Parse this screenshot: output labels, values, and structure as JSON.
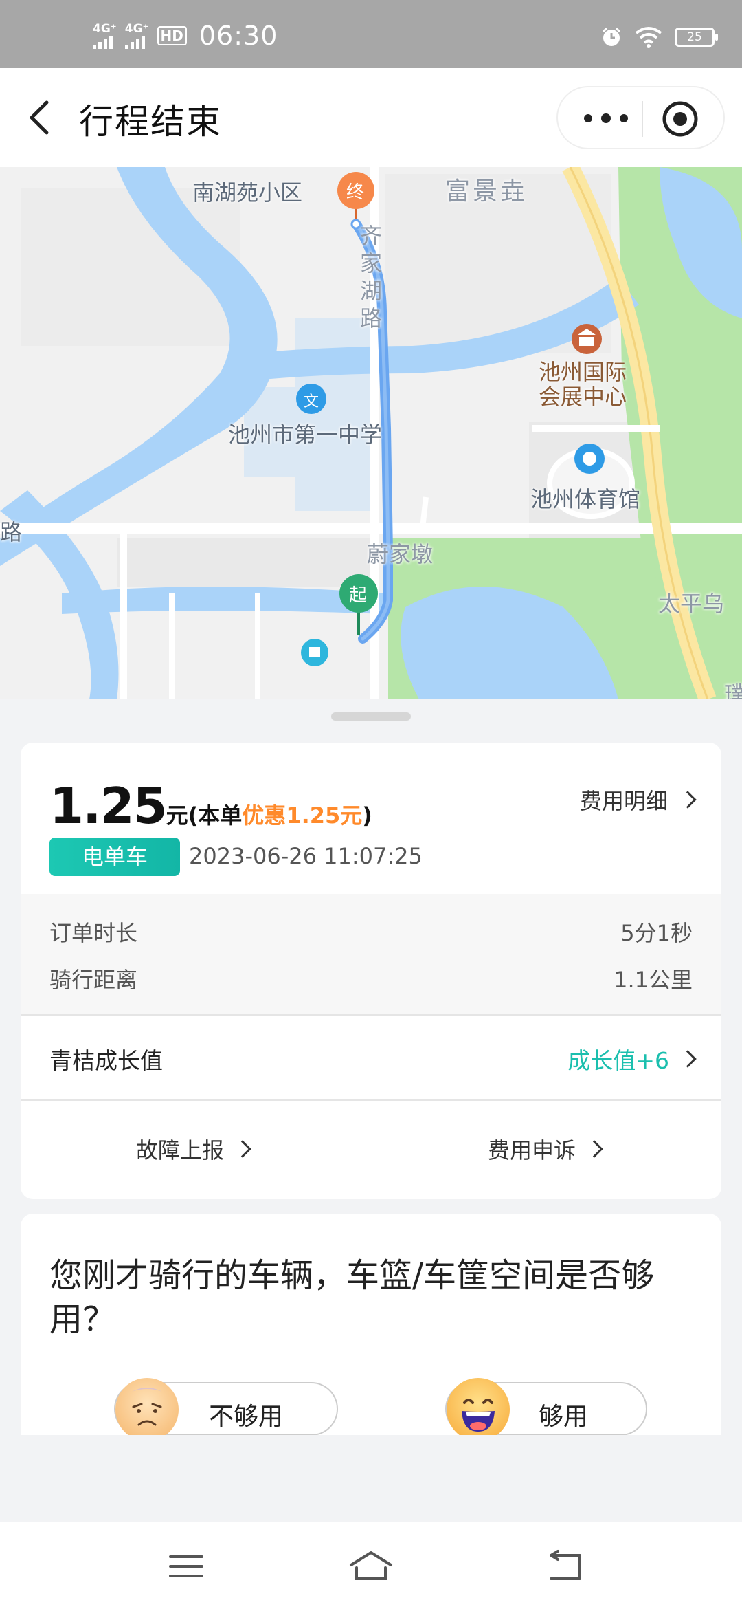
{
  "status_bar": {
    "network1": "4G⁺",
    "network2": "4G⁺",
    "hd": "HD",
    "time": "06:30",
    "battery": "25"
  },
  "header": {
    "title": "行程结束"
  },
  "map": {
    "labels": {
      "nanhuyuan": "南湖苑小区",
      "fujingyi": "富景垚",
      "road_vertical": "齐家湖路",
      "exhibition_line1": "池州国际",
      "exhibition_line2": "会展中心",
      "school": "池州市第一中学",
      "stadium": "池州体育馆",
      "left_road": "路",
      "shejiadun": "蔚家墩",
      "taiping": "太平乌",
      "edge": "璞"
    },
    "markers": {
      "end": "终",
      "start": "起",
      "school_icon": "文"
    }
  },
  "trip": {
    "price": "1.25",
    "price_unit": "元(本单",
    "discount": "优惠1.25元",
    "price_close": ")",
    "fee_detail_link": "费用明细",
    "vehicle_type": "电单车",
    "order_time": "2023-06-26 11:07:25",
    "duration_label": "订单时长",
    "duration_value": "5分1秒",
    "distance_label": "骑行距离",
    "distance_value": "1.1公里",
    "growth_label": "青桔成长值",
    "growth_value": "成长值+6",
    "fault_report": "故障上报",
    "fee_appeal": "费用申诉"
  },
  "survey": {
    "question": "您刚才骑行的车辆，车篮/车筐空间是否够用？",
    "option_no": "不够用",
    "option_yes": "够用"
  },
  "colors": {
    "accent_teal": "#1bbfae",
    "discount_orange": "#ff8a2b",
    "route_blue": "#6aa6f0",
    "water": "#aad3f9",
    "park": "#b6e5a8"
  }
}
